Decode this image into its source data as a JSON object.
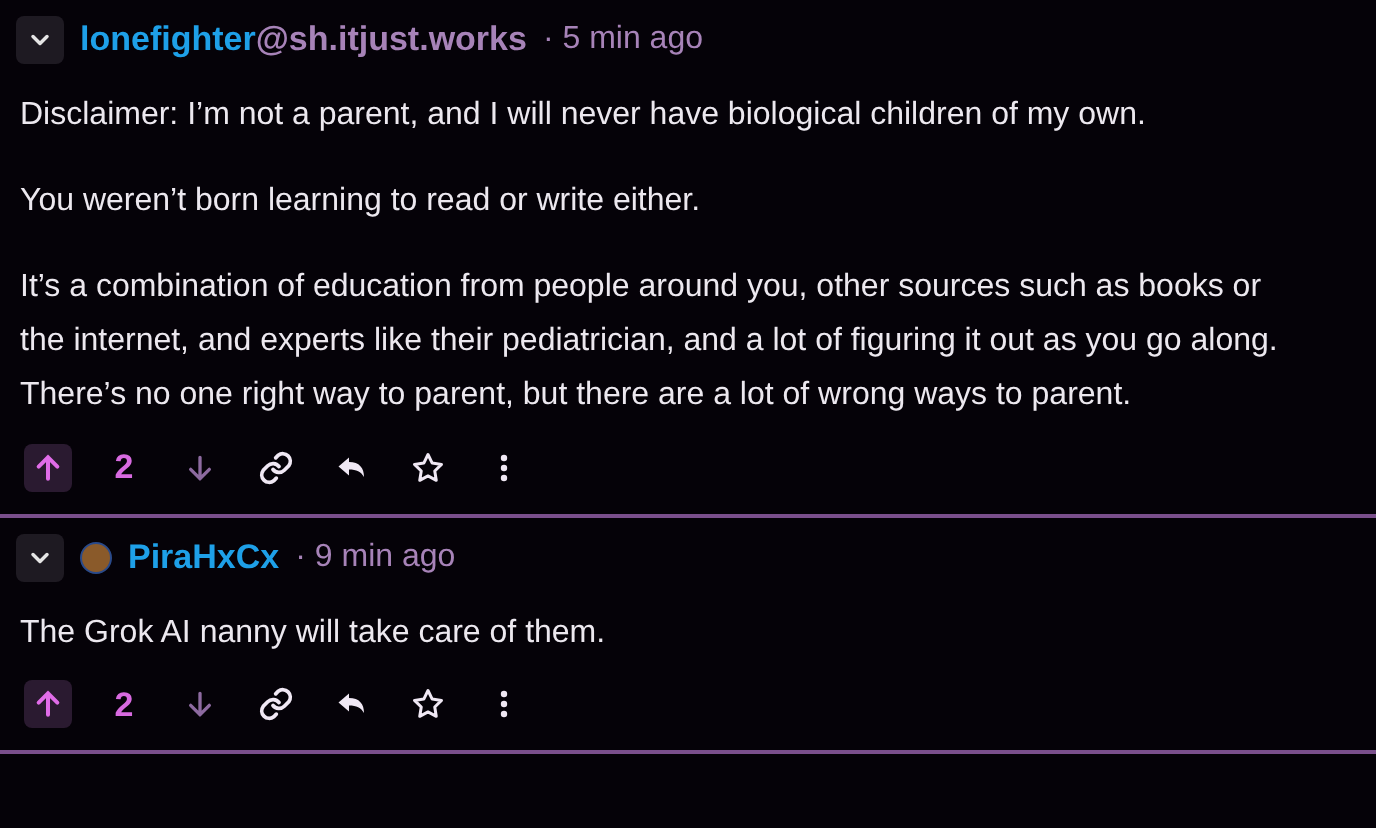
{
  "comments": [
    {
      "user": "lonefighter",
      "instance": "@sh.itjust.works",
      "has_avatar": false,
      "separator": "·",
      "time": "5 min ago",
      "expanded": true,
      "paragraphs": [
        "Disclaimer: I’m not a parent, and I will never have biological children of my own.",
        "You weren’t born learning to read or write either.",
        "It’s a combination of education from people around you, other sources such as books or the internet, and experts like their pediatrician, and a lot of figuring it out as you go along. There’s no one right way to parent, but there are a lot of wrong ways to parent."
      ],
      "upvoted": true,
      "score": "2"
    },
    {
      "user": "PiraHxCx",
      "has_avatar": true,
      "separator": "·",
      "time": "9 min ago",
      "expanded": true,
      "paragraphs": [
        "The Grok AI nanny will take care of them."
      ],
      "upvoted": true,
      "score": "2"
    }
  ]
}
